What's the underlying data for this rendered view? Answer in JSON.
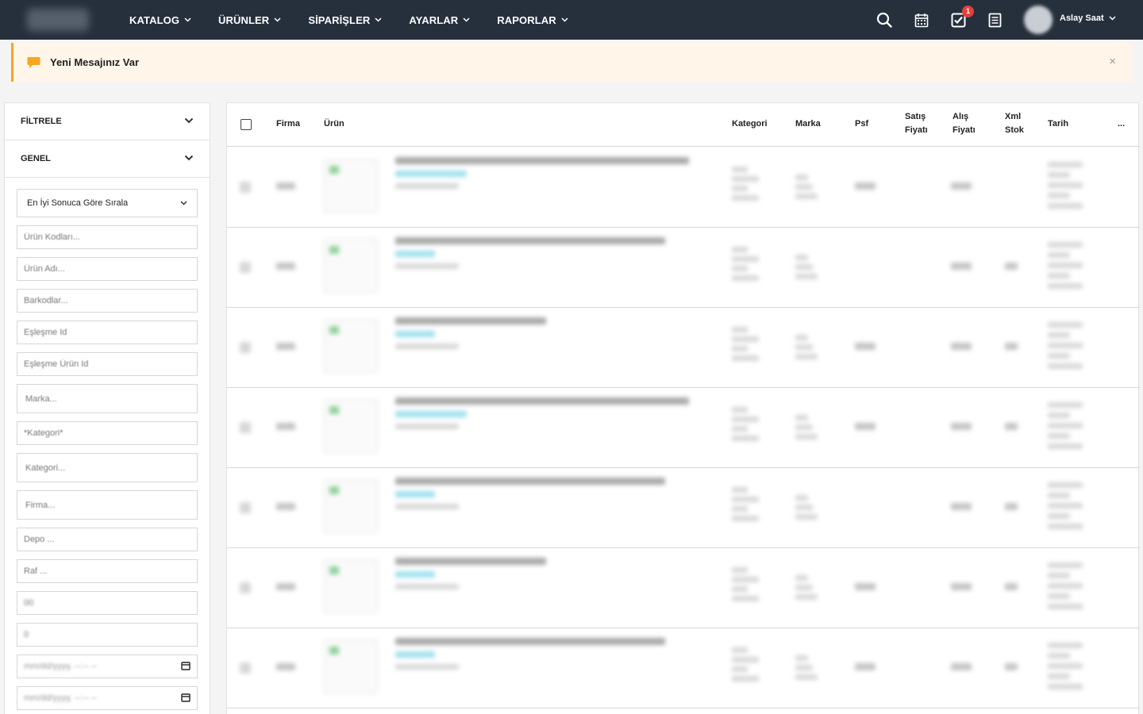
{
  "nav": {
    "menu": [
      {
        "label": "KATALOG"
      },
      {
        "label": "ÜRÜNLER"
      },
      {
        "label": "SİPARİŞLER"
      },
      {
        "label": "AYARLAR"
      },
      {
        "label": "RAPORLAR"
      }
    ],
    "tasks_badge": "1",
    "user_name": "Aslay Saat"
  },
  "notice": {
    "text": "Yeni Mesajınız Var",
    "close": "×"
  },
  "sidebar": {
    "filter_title": "FİLTRELE",
    "general_title": "GENEL",
    "sort_value": "En İyi Sonuca Göre Sırala",
    "fields": {
      "product_codes": "Ürün Kodları...",
      "product_name": "Ürün Adı...",
      "barcodes": "Barkodlar...",
      "match_id": "Eşleşme Id",
      "match_product_id": "Eşleşme Ürün Id",
      "brand": "Marka...",
      "category_star": "*Kategori*",
      "category": "Kategori...",
      "company": "Firma...",
      "warehouse": "Depo ...",
      "shelf": "Raf ...",
      "field_a": "00",
      "field_b": "0",
      "date_1": "mm/dd/yyyy, --:-- --",
      "date_2": "mm/dd/yyyy, --:-- --"
    }
  },
  "table": {
    "headers": {
      "firma": "Firma",
      "urun": "Ürün",
      "kategori": "Kategori",
      "marka": "Marka",
      "psf": "Psf",
      "satis_1": "Satış",
      "satis_2": "Fiyatı",
      "alis_1": "Alış",
      "alis_2": "Fiyatı",
      "xml_1": "Xml",
      "xml_2": "Stok",
      "tarih": "Tarih",
      "more": "..."
    },
    "row_count": 7
  },
  "colors": {
    "navbar": "#26303d",
    "notice_bg": "#fff5e8",
    "notice_accent": "#f5a623",
    "badge": "#e5403a"
  }
}
